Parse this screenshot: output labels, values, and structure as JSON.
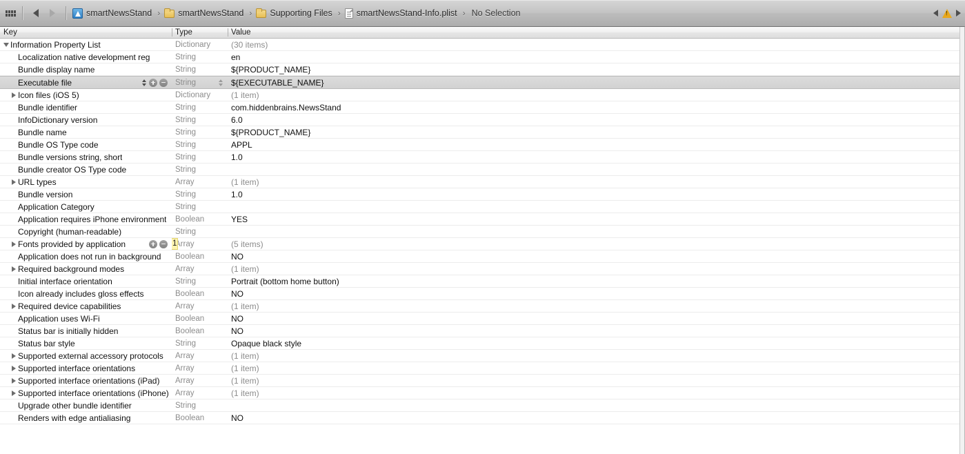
{
  "toolbar": {
    "grid_icon": "grid-icon",
    "back_label": "back-arrow",
    "forward_label": "forward-arrow",
    "breadcrumb": [
      {
        "label": "smartNewsStand",
        "icon": "xcode-project-icon"
      },
      {
        "label": "smartNewsStand",
        "icon": "folder-icon"
      },
      {
        "label": "Supporting Files",
        "icon": "folder-icon"
      },
      {
        "label": "smartNewsStand-Info.plist",
        "icon": "plist-document-icon"
      },
      {
        "label": "No Selection",
        "icon": ""
      }
    ],
    "separator": "›",
    "issue_icon": "warning-triangle-icon",
    "prev_issue": "previous-issue-arrow",
    "next_issue": "next-issue-arrow"
  },
  "table": {
    "headers": {
      "key": "Key",
      "type": "Type",
      "value": "Value"
    },
    "rows": [
      {
        "key": "Information Property List",
        "type": "Dictionary",
        "value": "(30 items)",
        "indent": 0,
        "disclosure": "down",
        "muted_value": true
      },
      {
        "key": "Localization native development reg",
        "type": "String",
        "value": "en",
        "indent": 1,
        "disclosure": "none"
      },
      {
        "key": "Bundle display name",
        "type": "String",
        "value": "${PRODUCT_NAME}",
        "indent": 1,
        "disclosure": "none"
      },
      {
        "key": "Executable file",
        "type": "String",
        "value": "${EXECUTABLE_NAME}",
        "indent": 1,
        "disclosure": "none",
        "selected": true,
        "widgets": true
      },
      {
        "key": "Icon files (iOS 5)",
        "type": "Dictionary",
        "value": "(1 item)",
        "indent": 1,
        "disclosure": "right",
        "muted_value": true
      },
      {
        "key": "Bundle identifier",
        "type": "String",
        "value": "com.hiddenbrains.NewsStand",
        "indent": 1,
        "disclosure": "none"
      },
      {
        "key": "InfoDictionary version",
        "type": "String",
        "value": "6.0",
        "indent": 1,
        "disclosure": "none"
      },
      {
        "key": "Bundle name",
        "type": "String",
        "value": "${PRODUCT_NAME}",
        "indent": 1,
        "disclosure": "none"
      },
      {
        "key": "Bundle OS Type code",
        "type": "String",
        "value": "APPL",
        "indent": 1,
        "disclosure": "none"
      },
      {
        "key": "Bundle versions string, short",
        "type": "String",
        "value": "1.0",
        "indent": 1,
        "disclosure": "none"
      },
      {
        "key": "Bundle creator OS Type code",
        "type": "String",
        "value": "",
        "indent": 1,
        "disclosure": "none"
      },
      {
        "key": "URL types",
        "type": "Array",
        "value": "(1 item)",
        "indent": 1,
        "disclosure": "right",
        "muted_value": true
      },
      {
        "key": "Bundle version",
        "type": "String",
        "value": "1.0",
        "indent": 1,
        "disclosure": "none"
      },
      {
        "key": "Application Category",
        "type": "String",
        "value": "",
        "indent": 1,
        "disclosure": "none"
      },
      {
        "key": "Application requires iPhone environment",
        "type": "Boolean",
        "value": "YES",
        "indent": 1,
        "disclosure": "none"
      },
      {
        "key": "Copyright (human-readable)",
        "type": "String",
        "value": "",
        "indent": 1,
        "disclosure": "none"
      },
      {
        "key": "Fonts provided by application",
        "type": "Array",
        "value": "(5 items)",
        "indent": 1,
        "disclosure": "right",
        "muted_value": true,
        "widgets_min_plus": true,
        "caret_badge": "1"
      },
      {
        "key": "Application does not run in background",
        "type": "Boolean",
        "value": "NO",
        "indent": 1,
        "disclosure": "none"
      },
      {
        "key": "Required background modes",
        "type": "Array",
        "value": "(1 item)",
        "indent": 1,
        "disclosure": "right",
        "muted_value": true
      },
      {
        "key": "Initial interface orientation",
        "type": "String",
        "value": "Portrait (bottom home button)",
        "indent": 1,
        "disclosure": "none"
      },
      {
        "key": "Icon already includes gloss effects",
        "type": "Boolean",
        "value": "NO",
        "indent": 1,
        "disclosure": "none"
      },
      {
        "key": "Required device capabilities",
        "type": "Array",
        "value": "(1 item)",
        "indent": 1,
        "disclosure": "right",
        "muted_value": true
      },
      {
        "key": "Application uses Wi-Fi",
        "type": "Boolean",
        "value": "NO",
        "indent": 1,
        "disclosure": "none"
      },
      {
        "key": "Status bar is initially hidden",
        "type": "Boolean",
        "value": "NO",
        "indent": 1,
        "disclosure": "none"
      },
      {
        "key": "Status bar style",
        "type": "String",
        "value": "Opaque black style",
        "indent": 1,
        "disclosure": "none"
      },
      {
        "key": "Supported external accessory protocols",
        "type": "Array",
        "value": "(1 item)",
        "indent": 1,
        "disclosure": "right",
        "muted_value": true
      },
      {
        "key": "Supported interface orientations",
        "type": "Array",
        "value": "(1 item)",
        "indent": 1,
        "disclosure": "right",
        "muted_value": true
      },
      {
        "key": "Supported interface orientations (iPad)",
        "type": "Array",
        "value": "(1 item)",
        "indent": 1,
        "disclosure": "right",
        "muted_value": true
      },
      {
        "key": "Supported interface orientations (iPhone)",
        "type": "Array",
        "value": "(1 item)",
        "indent": 1,
        "disclosure": "right",
        "muted_value": true
      },
      {
        "key": "Upgrade other bundle identifier",
        "type": "String",
        "value": "",
        "indent": 1,
        "disclosure": "none"
      },
      {
        "key": "Renders with edge antialiasing",
        "type": "Boolean",
        "value": "NO",
        "indent": 1,
        "disclosure": "none"
      }
    ]
  }
}
